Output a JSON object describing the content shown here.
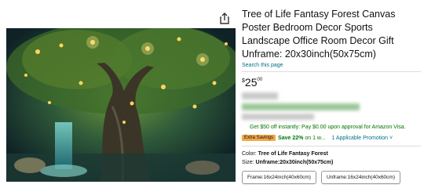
{
  "product": {
    "title": "Tree of Life Fantasy Forest Canvas Poster Bedroom Decor Sports Landscape Office Room Decor Gift Unframe: 20x30inch(50x75cm)",
    "search_link": "Search this page",
    "price": {
      "symbol": "$",
      "whole": "25",
      "fraction": "00"
    },
    "offer_text": "Get $50 off instantly: Pay $0.00 upon approval for Amazon Visa.",
    "promo": {
      "badge": "Extra Savings",
      "save": "Save 22%",
      "rest": "on 1 w...",
      "link": "1 Applicable Promotion",
      "chevron": "˅"
    },
    "color_label": "Color:",
    "color_value": "Tree of Life Fantasy Forest",
    "size_label": "Size:",
    "size_value": "Unframe:20x30inch(50x75cm)",
    "options": [
      "Frame:16x24inch(40x60cm)",
      "Unframe:16x24inch(40x60cm)"
    ]
  },
  "icons": {
    "share": "share-icon"
  },
  "colors": {
    "link": "#007185",
    "green": "#007600",
    "badge": "#f3a847"
  }
}
